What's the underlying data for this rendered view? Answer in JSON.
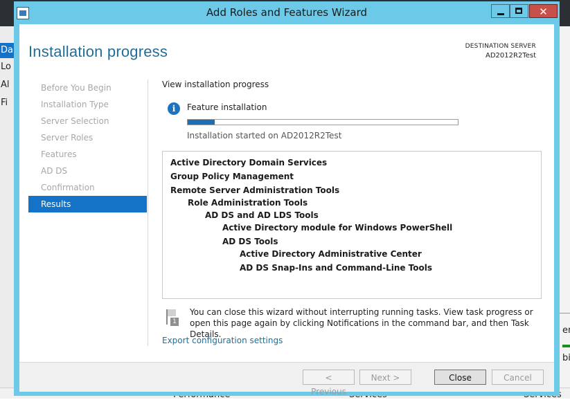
{
  "background_app": {
    "left_items": [
      "Da",
      "Lo",
      "Al",
      "Fi"
    ],
    "right_texts": [
      "ers",
      "bi"
    ],
    "bottom_texts": [
      "Performance",
      "Services",
      "Services"
    ]
  },
  "window": {
    "title": "Add Roles and Features Wizard",
    "close_glyph": "✕"
  },
  "header": {
    "title": "Installation progress",
    "destination_label": "DESTINATION SERVER",
    "destination_value": "AD2012R2Test"
  },
  "nav": {
    "items": [
      {
        "label": "Before You Begin"
      },
      {
        "label": "Installation Type"
      },
      {
        "label": "Server Selection"
      },
      {
        "label": "Server Roles"
      },
      {
        "label": "Features"
      },
      {
        "label": "AD DS"
      },
      {
        "label": "Confirmation"
      },
      {
        "label": "Results"
      }
    ],
    "active": "Results"
  },
  "main": {
    "section_title": "View installation progress",
    "info_icon_glyph": "i",
    "feature_label": "Feature installation",
    "progress_fraction": 0.1,
    "started_text": "Installation started on AD2012R2Test",
    "results": [
      {
        "label": "Active Directory Domain Services",
        "level": 0
      },
      {
        "label": "Group Policy Management",
        "level": 0
      },
      {
        "label": "Remote Server Administration Tools",
        "level": 0
      },
      {
        "label": "Role Administration Tools",
        "level": 1
      },
      {
        "label": "AD DS and AD LDS Tools",
        "level": 2
      },
      {
        "label": "Active Directory module for Windows PowerShell",
        "level": 3
      },
      {
        "label": "AD DS Tools",
        "level": 3
      },
      {
        "label": "Active Directory Administrative Center",
        "level": 4
      },
      {
        "label": "AD DS Snap-Ins and Command-Line Tools",
        "level": 4
      }
    ],
    "note_badge": "1",
    "note": "You can close this wizard without interrupting running tasks. View task progress or open this page again by clicking Notifications in the command bar, and then Task Details.",
    "export_link": "Export configuration settings"
  },
  "footer": {
    "previous_label": "< Previous",
    "next_label": "Next >",
    "close_label": "Close",
    "cancel_label": "Cancel"
  },
  "colors": {
    "title_bar": "#6cc9e8",
    "accent": "#1473c6",
    "heading": "#1f6f9a",
    "progress": "#1b6fb5"
  }
}
